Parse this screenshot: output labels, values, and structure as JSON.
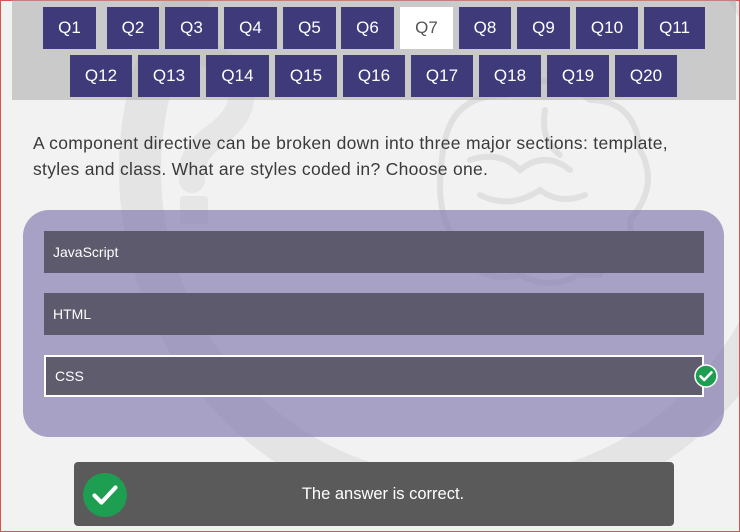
{
  "nav": {
    "row1": [
      "Q1",
      "Q2",
      "Q3",
      "Q4",
      "Q5",
      "Q6",
      "Q7",
      "Q8",
      "Q9",
      "Q10",
      "Q11"
    ],
    "row2": [
      "Q12",
      "Q13",
      "Q14",
      "Q15",
      "Q16",
      "Q17",
      "Q18",
      "Q19",
      "Q20"
    ],
    "active": "Q7"
  },
  "question": {
    "text": "A component directive can be broken down into three major sections: template, styles and class. What are styles coded in? Choose one."
  },
  "options": [
    {
      "label": "JavaScript",
      "selected": false
    },
    {
      "label": "HTML",
      "selected": false
    },
    {
      "label": "CSS",
      "selected": true
    }
  ],
  "result": {
    "text": "The answer is correct.",
    "icon": "check-circle-icon"
  },
  "colors": {
    "nav_button": "#3f3b7a",
    "nav_active": "#ffffff",
    "panel": "#8f88b8",
    "option": "#5c5a6c",
    "correct": "#1e9e50",
    "result_bg": "#5a5a5a"
  }
}
